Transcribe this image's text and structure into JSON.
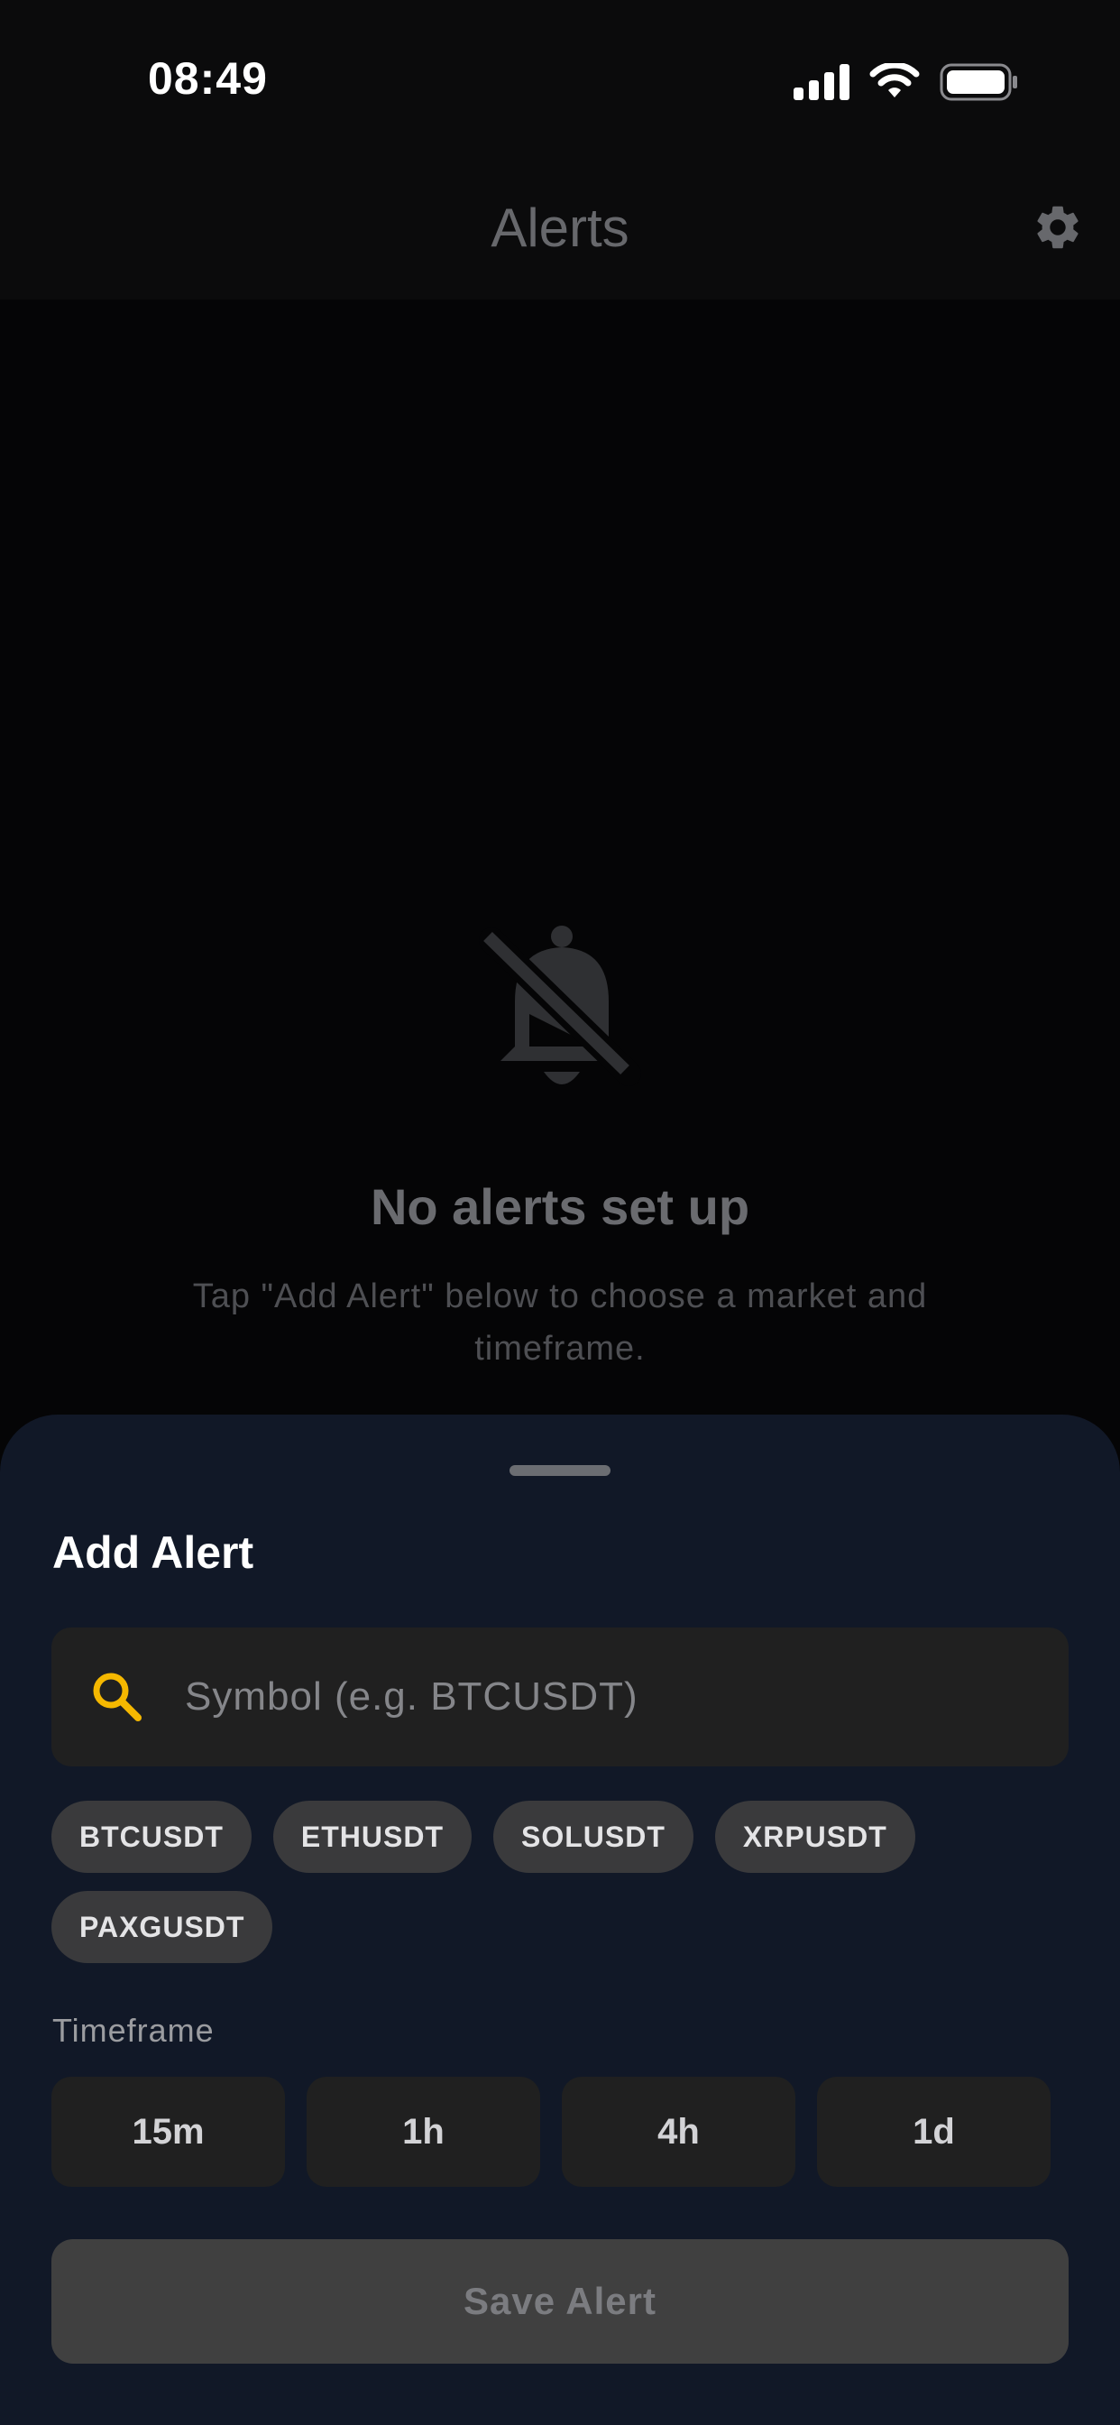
{
  "status_bar": {
    "time": "08:49",
    "icons": [
      "cellular-signal-icon",
      "wifi-icon",
      "battery-icon"
    ]
  },
  "header": {
    "title": "Alerts",
    "settings_icon": "gear-icon"
  },
  "empty_state": {
    "icon": "bell-slash-icon",
    "title": "No alerts set up",
    "subtitle": "Tap \"Add Alert\" below to choose a market and timeframe."
  },
  "sheet": {
    "title": "Add Alert",
    "search": {
      "placeholder": "Symbol (e.g. BTCUSDT)",
      "value": "",
      "icon": "search-icon"
    },
    "symbol_chips": [
      "BTCUSDT",
      "ETHUSDT",
      "SOLUSDT",
      "XRPUSDT",
      "PAXGUSDT"
    ],
    "timeframe_label": "Timeframe",
    "timeframes": [
      "15m",
      "1h",
      "4h",
      "1d"
    ],
    "save_label": "Save Alert"
  },
  "colors": {
    "accent": "#F5B800",
    "sheet_background": "#111827",
    "screen_background": "#050506"
  }
}
